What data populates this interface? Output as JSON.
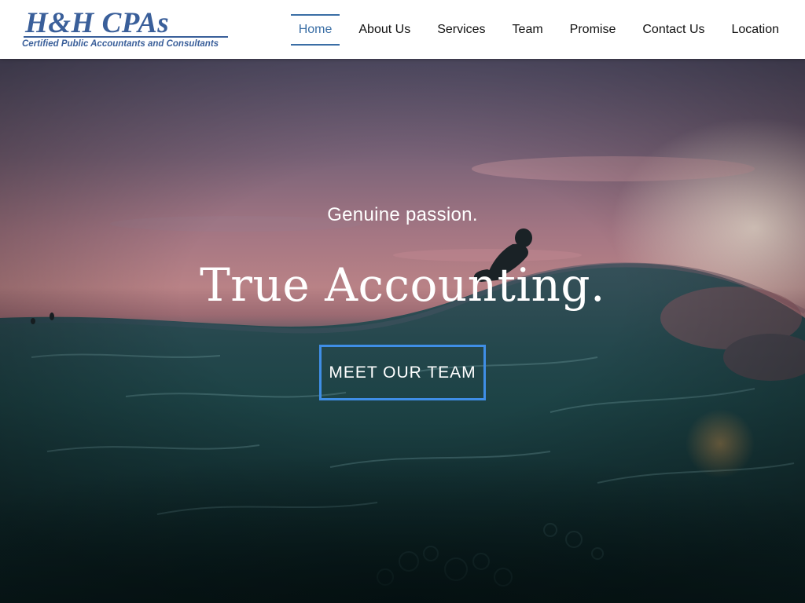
{
  "brand": {
    "title": "H&H CPAs",
    "subtitle": "Certified Public Accountants and Consultants",
    "color": "#3a5f9a"
  },
  "nav": {
    "items": [
      {
        "label": "Home",
        "active": true
      },
      {
        "label": "About Us",
        "active": false
      },
      {
        "label": "Services",
        "active": false
      },
      {
        "label": "Team",
        "active": false
      },
      {
        "label": "Promise",
        "active": false
      },
      {
        "label": "Contact Us",
        "active": false
      },
      {
        "label": "Location",
        "active": false
      }
    ],
    "active_color": "#3a6ea5"
  },
  "hero": {
    "tagline": "Genuine passion.",
    "title": "True Accounting.",
    "button_label": "MEET OUR TEAM",
    "button_border_color": "#3f8ee6",
    "background_subject": "surfer-at-sunset-ocean-wave"
  }
}
